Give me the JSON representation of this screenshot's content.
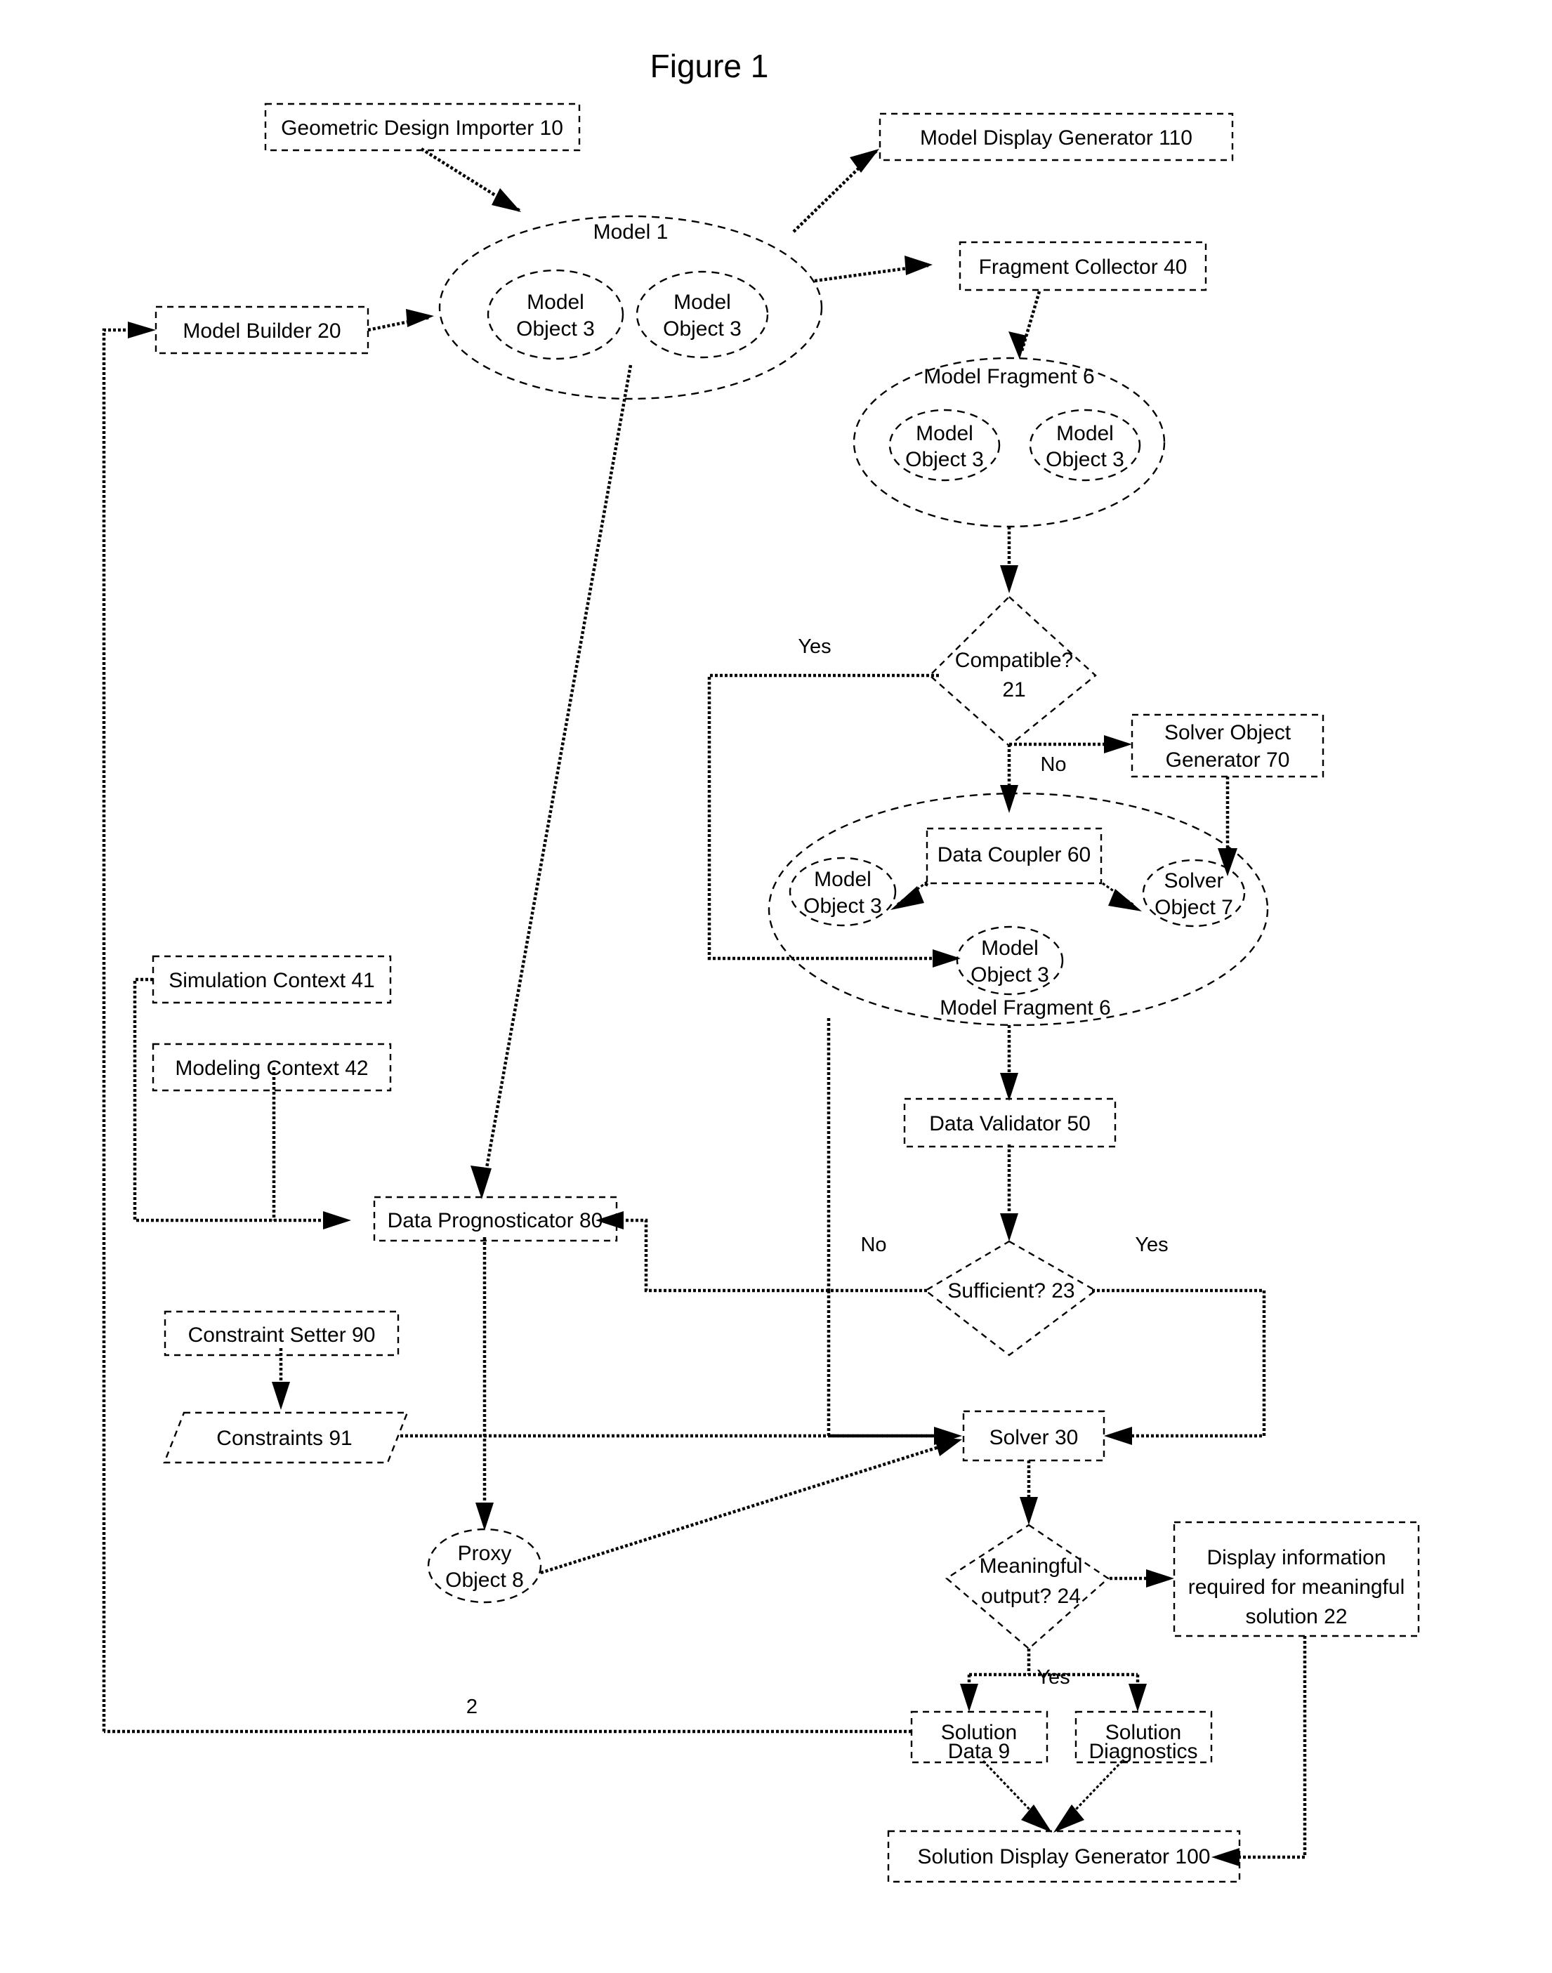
{
  "figure": {
    "title": "Figure 1",
    "system_ref": "2"
  },
  "nodes": {
    "geometric_design_importer": "Geometric Design Importer 10",
    "model_display_generator": "Model Display Generator 110",
    "fragment_collector": "Fragment Collector 40",
    "model_builder": "Model Builder 20",
    "model_1": "Model 1",
    "model_object_a": "Model",
    "model_object_a2": "Object 3",
    "model_object_b": "Model",
    "model_object_b2": "Object 3",
    "model_fragment_top": "Model Fragment 6",
    "mf_obj_a_l1": "Model",
    "mf_obj_a_l2": "Object 3",
    "mf_obj_b_l1": "Model",
    "mf_obj_b_l2": "Object 3",
    "compatible_l1": "Compatible?",
    "compatible_l2": "21",
    "solver_object_generator_l1": "Solver Object",
    "solver_object_generator_l2": "Generator 70",
    "data_coupler": "Data Coupler 60",
    "mf2_model_obj_l1": "Model",
    "mf2_model_obj_l2": "Object 3",
    "mf2_solver_obj_l1": "Solver",
    "mf2_solver_obj_l2": "Object 7",
    "mf2_model_obj2_l1": "Model",
    "mf2_model_obj2_l2": "Object 3",
    "model_fragment_bottom": "Model Fragment 6",
    "data_validator": "Data Validator 50",
    "sufficient": "Sufficient? 23",
    "simulation_context": "Simulation Context 41",
    "modeling_context": "Modeling Context 42",
    "data_prognosticator": "Data Prognosticator 80",
    "constraint_setter": "Constraint Setter 90",
    "constraints": "Constraints 91",
    "proxy_object_l1": "Proxy",
    "proxy_object_l2": "Object 8",
    "solver": "Solver 30",
    "meaningful_output_l1": "Meaningful",
    "meaningful_output_l2": "output? 24",
    "display_info_l1": "Display information",
    "display_info_l2": "required for meaningful",
    "display_info_l3": "solution 22",
    "solution_data_l1": "Solution",
    "solution_data_l2": "Data 9",
    "solution_diagnostics_l1": "Solution",
    "solution_diagnostics_l2": "Diagnostics",
    "solution_display_generator": "Solution Display Generator 100"
  },
  "edge_labels": {
    "compatible_yes": "Yes",
    "compatible_no": "No",
    "sufficient_no": "No",
    "sufficient_yes": "Yes",
    "meaningful_yes": "Yes"
  },
  "chart_data": {
    "type": "diagram",
    "title": "Figure 1",
    "shapes": [
      {
        "id": "geometric_design_importer",
        "kind": "box-dashed",
        "label": "Geometric Design Importer 10"
      },
      {
        "id": "model_display_generator",
        "kind": "box-dashed",
        "label": "Model Display Generator 110"
      },
      {
        "id": "fragment_collector",
        "kind": "box-dashed",
        "label": "Fragment Collector 40"
      },
      {
        "id": "model_builder",
        "kind": "box-dashed",
        "label": "Model Builder 20"
      },
      {
        "id": "model_1",
        "kind": "ellipse-dashed",
        "label": "Model 1"
      },
      {
        "id": "model_object_a",
        "kind": "ellipse-dashed",
        "label": "Model Object 3"
      },
      {
        "id": "model_object_b",
        "kind": "ellipse-dashed",
        "label": "Model Object 3"
      },
      {
        "id": "model_fragment_top",
        "kind": "ellipse-dashed",
        "label": "Model Fragment 6"
      },
      {
        "id": "compatible",
        "kind": "diamond-dashed",
        "label": "Compatible? 21"
      },
      {
        "id": "solver_object_generator",
        "kind": "box-dashed",
        "label": "Solver Object Generator 70"
      },
      {
        "id": "data_coupler",
        "kind": "box-dashed",
        "label": "Data Coupler 60"
      },
      {
        "id": "model_fragment_bottom",
        "kind": "ellipse-dashed",
        "label": "Model Fragment 6"
      },
      {
        "id": "data_validator",
        "kind": "box-dashed",
        "label": "Data Validator 50"
      },
      {
        "id": "sufficient",
        "kind": "diamond-dashed",
        "label": "Sufficient? 23"
      },
      {
        "id": "simulation_context",
        "kind": "box-dashed",
        "label": "Simulation Context 41"
      },
      {
        "id": "modeling_context",
        "kind": "box-dashed",
        "label": "Modeling Context 42"
      },
      {
        "id": "data_prognosticator",
        "kind": "box-dashed",
        "label": "Data Prognosticator 80"
      },
      {
        "id": "constraint_setter",
        "kind": "box-dashed",
        "label": "Constraint Setter 90"
      },
      {
        "id": "constraints",
        "kind": "parallelogram-dashed",
        "label": "Constraints 91"
      },
      {
        "id": "proxy_object",
        "kind": "ellipse-dashed",
        "label": "Proxy Object 8"
      },
      {
        "id": "solver",
        "kind": "box-dashed",
        "label": "Solver 30"
      },
      {
        "id": "meaningful_output",
        "kind": "diamond-dashed",
        "label": "Meaningful output? 24"
      },
      {
        "id": "display_info",
        "kind": "box-dashed",
        "label": "Display information required for meaningful solution 22"
      },
      {
        "id": "solution_data",
        "kind": "box-dashed",
        "label": "Solution Data 9"
      },
      {
        "id": "solution_diagnostics",
        "kind": "box-dashed",
        "label": "Solution Diagnostics"
      },
      {
        "id": "solution_display_generator",
        "kind": "box-dashed",
        "label": "Solution Display Generator 100"
      }
    ],
    "edges": [
      {
        "from": "geometric_design_importer",
        "to": "model_1",
        "label": ""
      },
      {
        "from": "model_builder",
        "to": "model_1",
        "label": ""
      },
      {
        "from": "model_1",
        "to": "model_display_generator",
        "label": ""
      },
      {
        "from": "model_1",
        "to": "fragment_collector",
        "label": ""
      },
      {
        "from": "fragment_collector",
        "to": "model_fragment_top",
        "label": ""
      },
      {
        "from": "model_fragment_top",
        "to": "compatible",
        "label": ""
      },
      {
        "from": "compatible",
        "to": "model_fragment_bottom",
        "label": "Yes"
      },
      {
        "from": "compatible",
        "to": "solver_object_generator",
        "label": "No"
      },
      {
        "from": "solver_object_generator",
        "to": "mf2_solver_obj",
        "label": ""
      },
      {
        "from": "data_coupler",
        "to": "mf2_model_obj",
        "label": ""
      },
      {
        "from": "data_coupler",
        "to": "mf2_solver_obj",
        "label": ""
      },
      {
        "from": "model_fragment_bottom",
        "to": "data_validator",
        "label": ""
      },
      {
        "from": "data_validator",
        "to": "sufficient",
        "label": ""
      },
      {
        "from": "sufficient",
        "to": "data_prognosticator",
        "label": "No"
      },
      {
        "from": "sufficient",
        "to": "solver",
        "label": "Yes"
      },
      {
        "from": "model_1",
        "to": "data_prognosticator",
        "label": ""
      },
      {
        "from": "simulation_context",
        "to": "data_prognosticator",
        "label": ""
      },
      {
        "from": "modeling_context",
        "to": "data_prognosticator",
        "label": ""
      },
      {
        "from": "data_prognosticator",
        "to": "proxy_object",
        "label": ""
      },
      {
        "from": "constraint_setter",
        "to": "constraints",
        "label": ""
      },
      {
        "from": "constraints",
        "to": "solver",
        "label": ""
      },
      {
        "from": "proxy_object",
        "to": "solver",
        "label": ""
      },
      {
        "from": "model_fragment_bottom",
        "to": "solver",
        "label": ""
      },
      {
        "from": "solver",
        "to": "meaningful_output",
        "label": ""
      },
      {
        "from": "meaningful_output",
        "to": "display_info",
        "label": ""
      },
      {
        "from": "meaningful_output",
        "to": "solution_data",
        "label": "Yes"
      },
      {
        "from": "meaningful_output",
        "to": "solution_diagnostics",
        "label": "Yes"
      },
      {
        "from": "solution_data",
        "to": "solution_display_generator",
        "label": ""
      },
      {
        "from": "solution_diagnostics",
        "to": "solution_display_generator",
        "label": ""
      },
      {
        "from": "display_info",
        "to": "solution_display_generator",
        "label": ""
      },
      {
        "from": "solution_data",
        "to": "model_builder",
        "label": "2"
      }
    ]
  }
}
